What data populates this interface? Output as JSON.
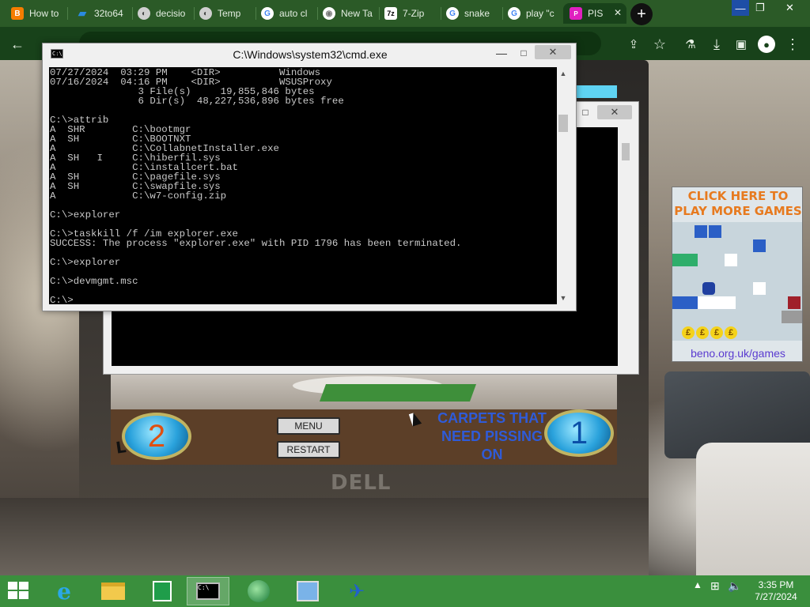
{
  "browser": {
    "tabs": [
      {
        "label": "How to",
        "icon": "blogger-icon",
        "color": "#f57d00"
      },
      {
        "label": "32to64",
        "icon": "azure-icon",
        "color": "#2a8ae0"
      },
      {
        "label": "decisio",
        "icon": "globe-icon",
        "color": "#d0d0d0"
      },
      {
        "label": "Temp",
        "icon": "globe-icon",
        "color": "#d0d0d0"
      },
      {
        "label": "auto cl",
        "icon": "google-icon",
        "color": "#ffffff"
      },
      {
        "label": "New Ta",
        "icon": "chrome-icon",
        "color": "#ffffff"
      },
      {
        "label": "7-Zip",
        "icon": "7zip-icon",
        "color": "#ffffff"
      },
      {
        "label": "snake",
        "icon": "google-icon",
        "color": "#ffffff"
      },
      {
        "label": "play \"c",
        "icon": "google-icon",
        "color": "#ffffff"
      },
      {
        "label": "PIS",
        "icon": "pis-icon",
        "color": "#e020c0"
      }
    ],
    "new_tab_glyph": "+",
    "window_buttons": {
      "minimize": "—",
      "maximize": "❐",
      "close": "✕"
    },
    "address_text": ""
  },
  "cmd": {
    "title": "C:\\Windows\\system32\\cmd.exe",
    "icon_label": "C:\\",
    "buttons": {
      "minimize": "—",
      "maximize": "□",
      "close": "✕"
    },
    "lines": [
      "07/27/2024  03:29 PM    <DIR>          Windows",
      "07/16/2024  04:16 PM    <DIR>          WSUSProxy",
      "               3 File(s)     19,855,846 bytes",
      "               6 Dir(s)  48,227,536,896 bytes free",
      "",
      "C:\\>attrib",
      "A  SHR        C:\\bootmgr",
      "A  SH         C:\\BOOTNXT",
      "A             C:\\CollabnetInstaller.exe",
      "A  SH   I     C:\\hiberfil.sys",
      "A             C:\\installcert.bat",
      "A  SH         C:\\pagefile.sys",
      "A  SH         C:\\swapfile.sys",
      "A             C:\\w7-config.zip",
      "",
      "C:\\>explorer",
      "",
      "C:\\>taskkill /f /im explorer.exe",
      "SUCCESS: The process \"explorer.exe\" with PID 1796 has been terminated.",
      "",
      "C:\\>explorer",
      "",
      "C:\\>devmgmt.msc",
      "",
      "C:\\>"
    ]
  },
  "game": {
    "level_label": "LEVEL",
    "level_number": "2",
    "menu_label": "MENU",
    "restart_label": "RESTART",
    "carpets_text": "CARPETS THAT NEED PISSING ON",
    "carpets_count": "1"
  },
  "ad": {
    "title": "CLICK HERE TO PLAY MORE GAMES",
    "coin_glyph": "£",
    "url": "beno.org.uk/games",
    "title_color": "#e77a1f"
  },
  "taskbar": {
    "apps": [
      {
        "name": "internet-explorer",
        "active": false
      },
      {
        "name": "file-explorer",
        "active": false
      },
      {
        "name": "store",
        "active": false
      },
      {
        "name": "cmd",
        "active": true
      },
      {
        "name": "network",
        "active": false
      },
      {
        "name": "remote-desktop",
        "active": false
      },
      {
        "name": "game",
        "active": false
      }
    ],
    "time": "3:35 PM",
    "date": "7/27/2024",
    "accent": "#3a8f3d"
  }
}
